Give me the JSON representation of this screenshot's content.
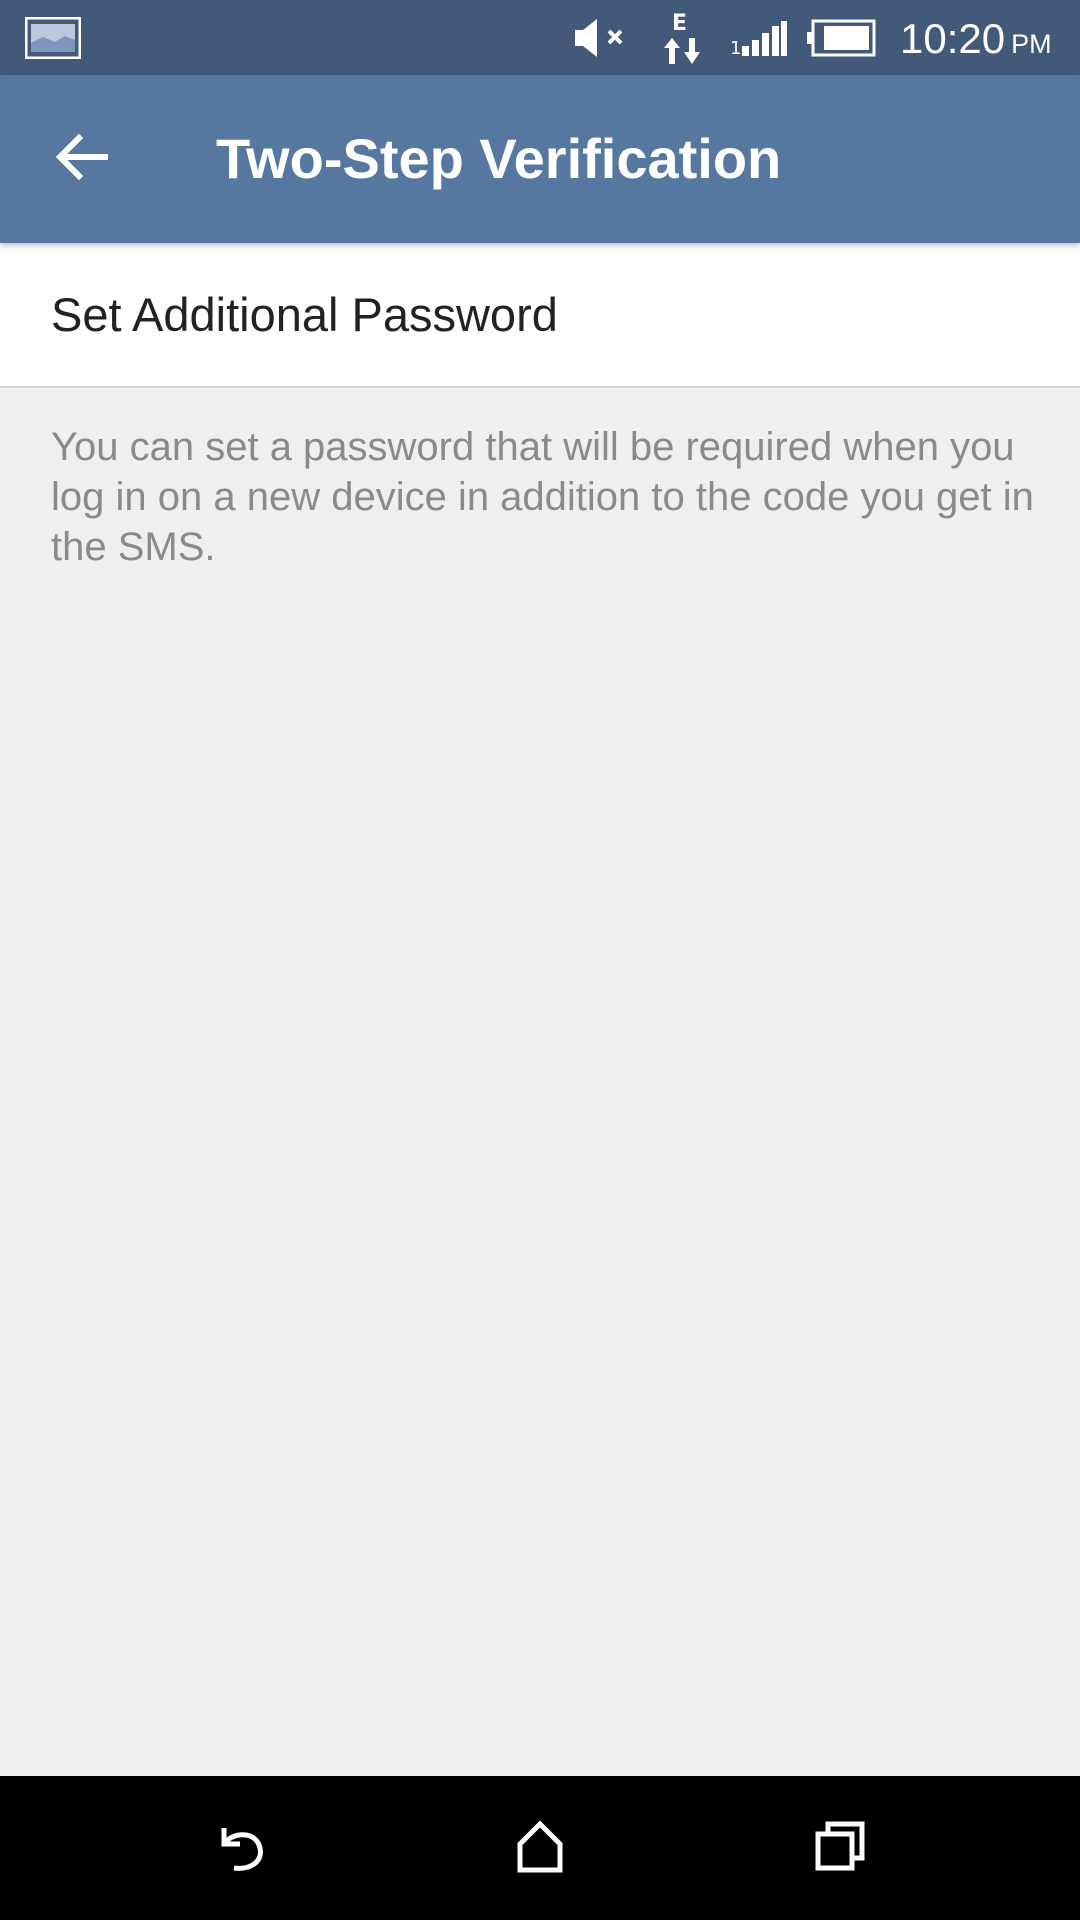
{
  "status_bar": {
    "time": "10:20",
    "ampm": "PM",
    "icons": [
      "gallery-notification-icon",
      "mute-icon",
      "edge-data-icon",
      "signal-icon",
      "battery-icon"
    ]
  },
  "app_bar": {
    "title": "Two-Step Verification",
    "back_icon": "arrow-back-icon"
  },
  "settings": {
    "row_label": "Set Additional Password",
    "info_text": "You can set a password that will be required when you log in on a new device in addition to the code you get in the SMS."
  },
  "nav_bar": {
    "icons": [
      "back-icon",
      "home-icon",
      "recents-icon"
    ]
  },
  "colors": {
    "status_bar": "#43597a",
    "app_bar": "#5677a0",
    "background": "#efefef",
    "row_background": "#ffffff",
    "info_text": "#8a8a8a",
    "nav_bar": "#000000"
  }
}
